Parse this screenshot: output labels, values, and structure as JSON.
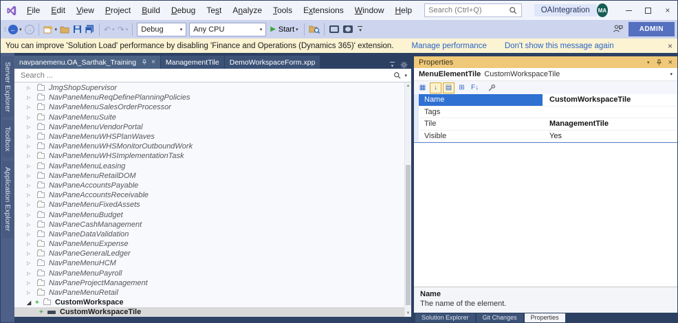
{
  "window": {
    "search_placeholder": "Search (Ctrl+Q)",
    "project_badge": "OAIntegration",
    "avatar": "MA"
  },
  "menu": {
    "items": [
      {
        "label": "File",
        "underline": 0
      },
      {
        "label": "Edit",
        "underline": 0
      },
      {
        "label": "View",
        "underline": 0
      },
      {
        "label": "Project",
        "underline": 0
      },
      {
        "label": "Build",
        "underline": 0
      },
      {
        "label": "Debug",
        "underline": 0
      },
      {
        "label": "Test",
        "underline": 2
      },
      {
        "label": "Analyze",
        "underline": 1
      },
      {
        "label": "Tools",
        "underline": 0
      },
      {
        "label": "Extensions",
        "underline": 1
      },
      {
        "label": "Window",
        "underline": 0
      },
      {
        "label": "Help",
        "underline": 0
      }
    ]
  },
  "toolbar": {
    "debug_config": "Debug",
    "platform": "Any CPU",
    "start_label": "Start",
    "admin_label": "ADMIN"
  },
  "notification": {
    "message": "You can improve 'Solution Load' performance by disabling 'Finance and Operations (Dynamics 365)' extension.",
    "links": [
      "Manage performance",
      "Don't show this message again"
    ]
  },
  "sidebar": {
    "tabs": [
      "Server Explorer",
      "Toolbox",
      "Application Explorer"
    ]
  },
  "editor": {
    "tabs": [
      {
        "label": "navpanemenu.OA_Sarthak_Training",
        "active": true
      },
      {
        "label": "ManagementTile",
        "active": false
      },
      {
        "label": "DemoWorkspaceForm.xpp",
        "active": false
      }
    ],
    "search_placeholder": "Search ...",
    "tree": {
      "items": [
        {
          "label": "JmgShopSupervisor"
        },
        {
          "label": "NavPaneMenuReqDefinePlanningPolicies"
        },
        {
          "label": "NavPaneMenuSalesOrderProcessor"
        },
        {
          "label": "NavPaneMenuSuite"
        },
        {
          "label": "NavPaneMenuVendorPortal"
        },
        {
          "label": "NavPaneMenuWHSPlanWaves"
        },
        {
          "label": "NavPaneMenuWHSMonitorOutboundWork"
        },
        {
          "label": "NavPaneMenuWHSImplementationTask"
        },
        {
          "label": "NavPaneMenuLeasing"
        },
        {
          "label": "NavPaneMenuRetailDOM"
        },
        {
          "label": "NavPaneAccountsPayable"
        },
        {
          "label": "NavPaneAccountsReceivable"
        },
        {
          "label": "NavPaneMenuFixedAssets"
        },
        {
          "label": "NavPaneMenuBudget"
        },
        {
          "label": "NavPaneCashManagement"
        },
        {
          "label": "NavPaneDataValidation"
        },
        {
          "label": "NavPaneMenuExpense"
        },
        {
          "label": "NavPaneGeneralLedger"
        },
        {
          "label": "NavPaneMenuHCM"
        },
        {
          "label": "NavPaneMenuPayroll"
        },
        {
          "label": "NavPaneProjectManagement"
        },
        {
          "label": "NavPaneMenuRetail"
        },
        {
          "label": "CustomWorkspace",
          "expanded": true,
          "bold": true,
          "plus": true
        },
        {
          "label": "CustomWorkspaceTile",
          "child": true,
          "bold": true,
          "plus": true,
          "selected": true,
          "icon": "tile"
        }
      ]
    }
  },
  "properties": {
    "title": "Properties",
    "object_type": "MenuElementTile",
    "object_name": "CustomWorkspaceTile",
    "toolbar_icons": [
      {
        "name": "categorized-icon",
        "glyph": "▦",
        "selected": false
      },
      {
        "name": "alphabetical-sort-icon",
        "glyph": "↓",
        "selected": true
      },
      {
        "name": "properties-page-icon",
        "glyph": "▤",
        "selected": true
      },
      {
        "name": "attached-properties-icon",
        "glyph": "⊞",
        "selected": false
      },
      {
        "name": "sort-order-icon",
        "glyph": "F↓",
        "selected": false
      }
    ],
    "rows": [
      {
        "name": "Name",
        "value": "CustomWorkspaceTile",
        "selected": true,
        "bold": true
      },
      {
        "name": "Tags",
        "value": "",
        "selected": false,
        "bold": false
      },
      {
        "name": "Tile",
        "value": "ManagementTile",
        "selected": false,
        "bold": true
      },
      {
        "name": "Visible",
        "value": "Yes",
        "selected": false,
        "bold": false
      }
    ],
    "description_title": "Name",
    "description_text": "The name of the element.",
    "bottom_tabs": [
      {
        "label": "Solution Explorer",
        "active": false
      },
      {
        "label": "Git Changes",
        "active": false
      },
      {
        "label": "Properties",
        "active": true
      }
    ]
  },
  "colors": {
    "titlebar_bg": "#f2f4fc",
    "toolbar_bg": "#ccd4ee",
    "notification_bg": "#fcf3d3",
    "link_blue": "#2a64c5",
    "dock_dark": "#2c4062",
    "tab_inactive": "#3c5277",
    "tab_active": "#4c6385",
    "properties_header": "#efc979",
    "selected_property": "#2f71d2",
    "selected_tree_row": "#d9d9d9",
    "vs_purple": "#8661c5",
    "admin_blue": "#5570bf",
    "avatar_teal": "#175d55",
    "start_green": "#3ba73b"
  }
}
